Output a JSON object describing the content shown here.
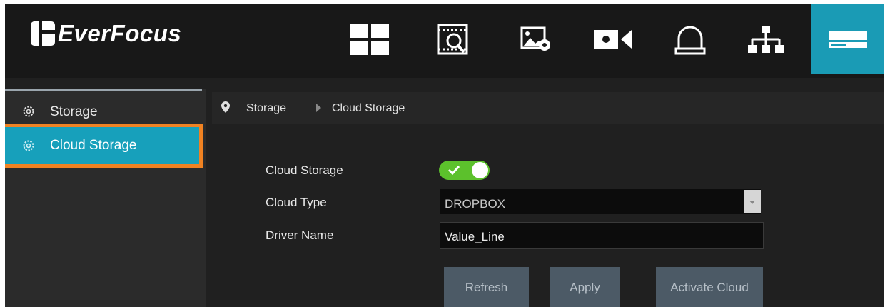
{
  "header": {
    "logo_text": "EverFocus",
    "nav": [
      {
        "icon": "grid-icon",
        "name": "live-view"
      },
      {
        "icon": "film-search-icon",
        "name": "playback-search"
      },
      {
        "icon": "image-gear-icon",
        "name": "image-settings"
      },
      {
        "icon": "camera-icon",
        "name": "camera"
      },
      {
        "icon": "alarm-bell-icon",
        "name": "alarm"
      },
      {
        "icon": "network-icon",
        "name": "network"
      },
      {
        "icon": "storage-drive-icon",
        "name": "storage",
        "active": true
      }
    ],
    "active_color": "#1a9bb5"
  },
  "sidebar": {
    "items": [
      {
        "label": "Storage",
        "icon": "gear-icon"
      },
      {
        "label": "Cloud Storage",
        "icon": "gear-icon",
        "selected": true
      }
    ],
    "highlight_color": "#f08222"
  },
  "breadcrumb": {
    "items": [
      "Storage",
      "Cloud Storage"
    ]
  },
  "form": {
    "cloud_storage_label": "Cloud Storage",
    "cloud_storage_enabled": true,
    "cloud_type_label": "Cloud Type",
    "cloud_type_value": "DROPBOX",
    "driver_name_label": "Driver Name",
    "driver_name_value": "Value_Line"
  },
  "buttons": {
    "refresh": "Refresh",
    "apply": "Apply",
    "activate": "Activate Cloud"
  }
}
